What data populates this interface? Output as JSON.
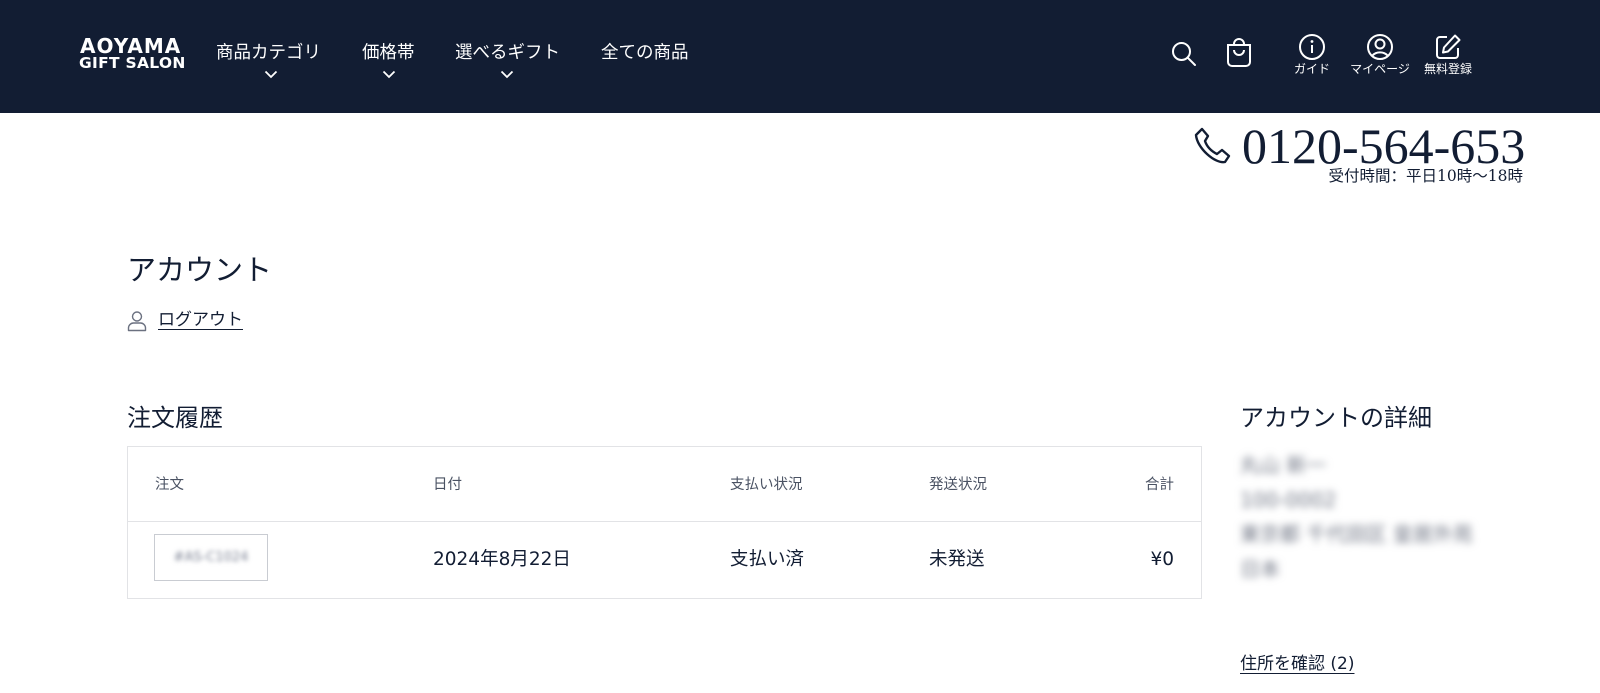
{
  "header": {
    "logo_line1": "AOYAMA",
    "logo_line2": "GIFT SALON",
    "nav": [
      {
        "label": "商品カテゴリ",
        "has_dropdown": true
      },
      {
        "label": "価格帯",
        "has_dropdown": true
      },
      {
        "label": "選べるギフト",
        "has_dropdown": true
      },
      {
        "label": "全ての商品",
        "has_dropdown": false
      }
    ],
    "icons": {
      "search": "search-icon",
      "cart": "cart-icon"
    },
    "guide_label": "ガイド",
    "mypage_label": "マイページ",
    "register_label": "無料登録"
  },
  "contact": {
    "phone": "0120-564-653",
    "hours": "受付時間：平日10時〜18時"
  },
  "account": {
    "title": "アカウント",
    "logout_label": "ログアウト"
  },
  "orders": {
    "title": "注文履歴",
    "headers": {
      "order": "注文",
      "date": "日付",
      "payment": "支払い状況",
      "fulfillment": "発送状況",
      "total": "合計"
    },
    "rows": [
      {
        "order_id": "#AS-C1024",
        "date": "2024年8月22日",
        "payment": "支払い済",
        "fulfillment": "未発送",
        "total": "¥0"
      }
    ]
  },
  "details": {
    "title": "アカウントの詳細",
    "name": "丸山 新一",
    "zip": "100-0002",
    "address": "東京都 千代田区 皇居外苑",
    "country": "日本",
    "addresses_link": "住所を確認 (2)"
  },
  "colors": {
    "header_bg": "#121d33",
    "text": "#121d33",
    "border": "#e2e3e6"
  }
}
